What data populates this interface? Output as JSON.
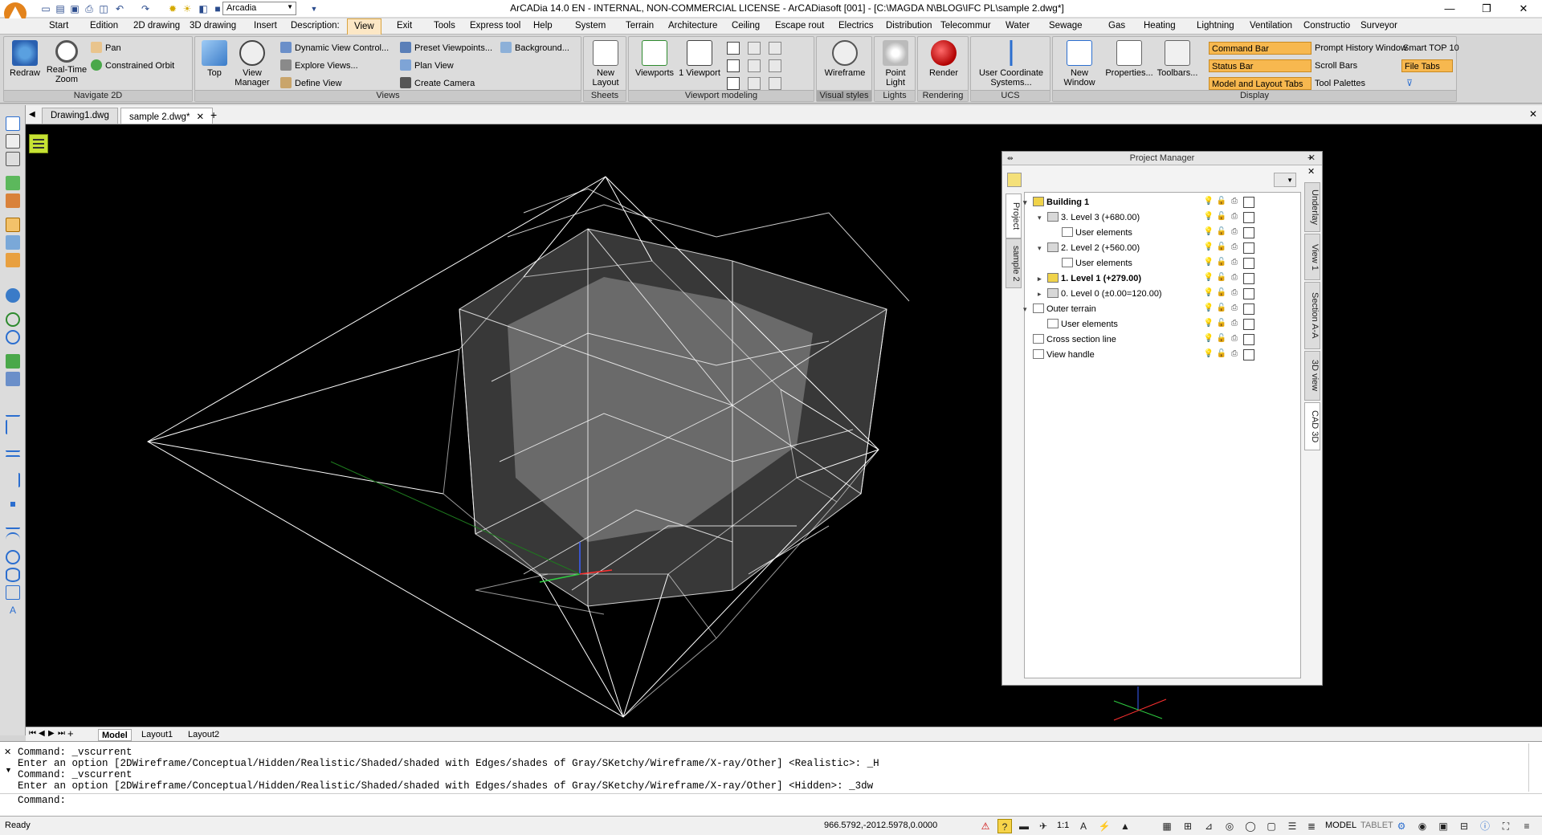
{
  "window": {
    "title": "ArCADia 14.0 EN - INTERNAL, NON-COMMERCIAL LICENSE - ArCADiasoft [001] - [C:\\MAGDA N\\BLOG\\IFC PL\\sample 2.dwg*]",
    "workspace": "Arcadia",
    "minimize": "—",
    "restore": "❐",
    "close": "✕"
  },
  "menu": [
    "Start",
    "Edition",
    "2D drawing",
    "3D drawing",
    "Insert",
    "Description:",
    "View",
    "Exit",
    "Tools",
    "Express tool",
    "Help",
    "System",
    "Terrain",
    "Architecture",
    "Ceiling",
    "Escape rout",
    "Electrics",
    "Distribution",
    "Telecommur",
    "Water",
    "Sewage",
    "Gas",
    "Heating",
    "Lightning",
    "Ventilation",
    "Constructio",
    "Surveyor"
  ],
  "ribbon": {
    "navigate2d": {
      "title": "Navigate 2D",
      "redraw": "Redraw",
      "realtime_zoom": "Real-Time Zoom",
      "pan": "Pan",
      "constrained_orbit": "Constrained Orbit"
    },
    "views": {
      "title": "Views",
      "top": "Top",
      "view_manager": "View Manager",
      "dynamic_view": "Dynamic View Control...",
      "explore_views": "Explore Views...",
      "define_view": "Define View",
      "preset_viewpoints": "Preset Viewpoints...",
      "plan_view": "Plan View",
      "create_camera": "Create Camera",
      "background": "Background..."
    },
    "sheets": {
      "title": "Sheets",
      "new_layout": "New Layout"
    },
    "viewport": {
      "title": "Viewport modeling",
      "viewports": "Viewports",
      "one_viewport": "1 Viewport"
    },
    "visual": {
      "title": "Visual styles",
      "wireframe": "Wireframe"
    },
    "lights": {
      "title": "Lights",
      "point_light": "Point Light"
    },
    "rendering": {
      "title": "Rendering",
      "render": "Render"
    },
    "ucs": {
      "title": "UCS",
      "user_coord": "User Coordinate Systems..."
    },
    "display": {
      "title": "Display",
      "new_window": "New Window",
      "properties": "Properties...",
      "toolbars": "Toolbars...",
      "command_bar": "Command Bar",
      "status_bar": "Status Bar",
      "model_layout_tabs": "Model and Layout Tabs",
      "prompt_history": "Prompt History Window",
      "scroll_bars": "Scroll Bars",
      "tool_palettes": "Tool Palettes",
      "smart_top": "Smart TOP 10",
      "file_tabs": "File Tabs"
    }
  },
  "file_tabs": [
    "Drawing1.dwg",
    "sample 2.dwg*"
  ],
  "project_manager": {
    "title": "Project Manager",
    "side_tabs": [
      "Project",
      "sample 2"
    ],
    "right_tabs": [
      "Underlay",
      "View 1",
      "Section A-A",
      "3D view",
      "CAD 3D"
    ],
    "tree": [
      {
        "label": "Building 1",
        "level": 0,
        "bold": true,
        "expanded": true
      },
      {
        "label": "3. Level 3 (+680.00)",
        "level": 1,
        "bold": false,
        "expanded": true
      },
      {
        "label": "User elements",
        "level": 2,
        "bold": false
      },
      {
        "label": "2. Level 2 (+560.00)",
        "level": 1,
        "bold": false,
        "expanded": true
      },
      {
        "label": "User elements",
        "level": 2,
        "bold": false
      },
      {
        "label": "1. Level 1 (+279.00)",
        "level": 1,
        "bold": true,
        "expanded": false
      },
      {
        "label": "0. Level 0 (±0.00=120.00)",
        "level": 1,
        "bold": false,
        "expanded": false
      },
      {
        "label": "Outer terrain",
        "level": 0,
        "bold": false,
        "expanded": true
      },
      {
        "label": "User elements",
        "level": 1,
        "bold": false
      },
      {
        "label": "Cross section line",
        "level": 0,
        "bold": false
      },
      {
        "label": "View handle",
        "level": 0,
        "bold": false
      }
    ]
  },
  "layout_tabs": [
    "Model",
    "Layout1",
    "Layout2"
  ],
  "command_history": [
    "Command: _vscurrent",
    "Enter an option [2DWireframe/Conceptual/Hidden/Realistic/Shaded/shaded with Edges/shades of Gray/SKetchy/Wireframe/X-ray/Other] <Realistic>: _H",
    "Command: _vscurrent",
    "Enter an option [2DWireframe/Conceptual/Hidden/Realistic/Shaded/shaded with Edges/shades of Gray/SKetchy/Wireframe/X-ray/Other] <Hidden>: _3dw",
    "Command:"
  ],
  "status": {
    "ready": "Ready",
    "coords": "966.5792,-2012.5978,0.0000",
    "scale": "1:1",
    "model": "MODEL",
    "tablet": "TABLET"
  },
  "colors": {
    "accent": "#f7b84f",
    "canvas": "#000000",
    "wire": "#ffffff"
  }
}
